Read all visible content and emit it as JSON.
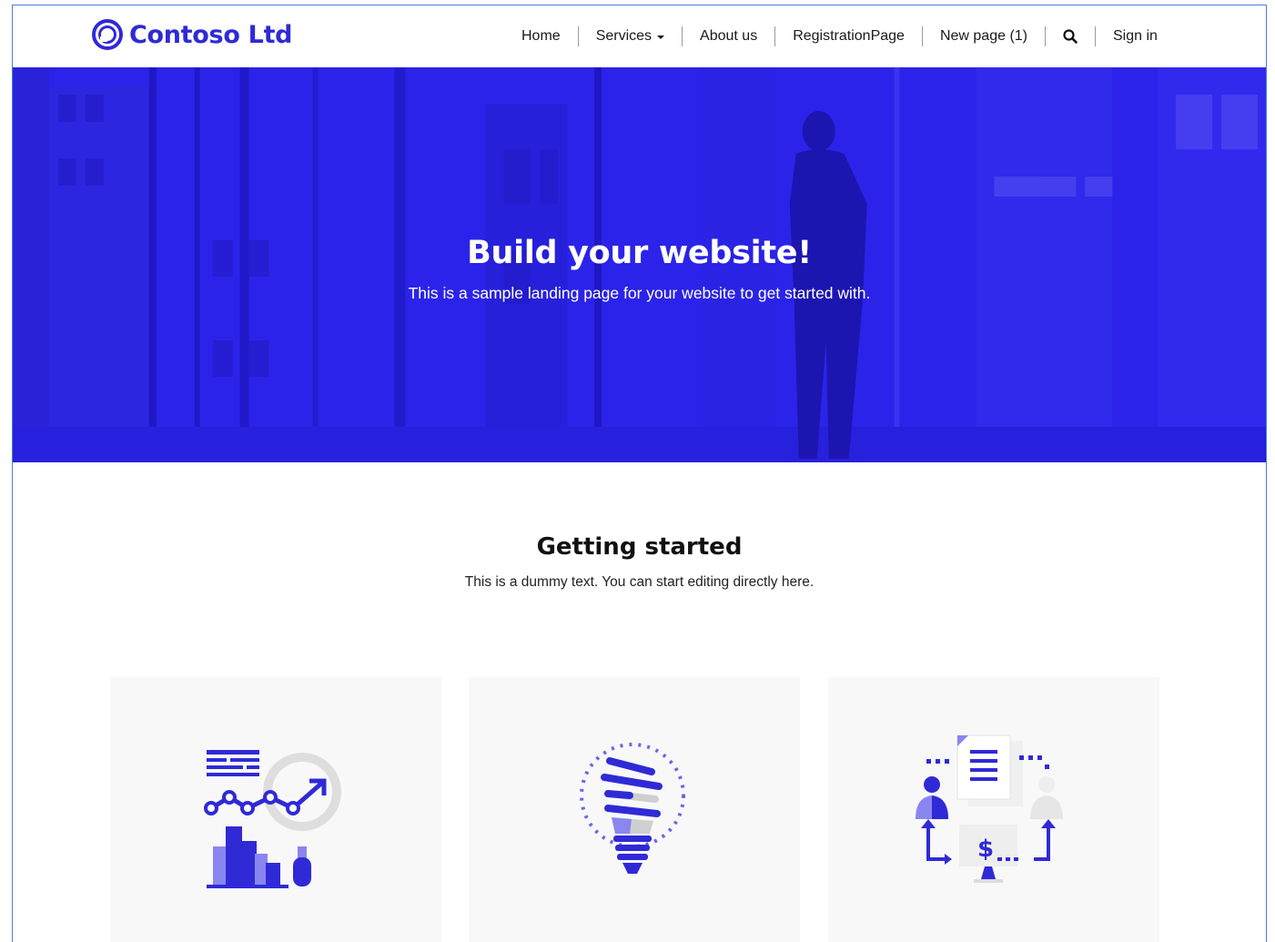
{
  "brand": {
    "name": "Contoso Ltd",
    "logo_icon": "ring-logo-icon",
    "color": "#2f2ad6"
  },
  "nav": {
    "home": "Home",
    "services": "Services",
    "about": "About us",
    "registration": "RegistrationPage",
    "new_page": "New page (1)",
    "search_icon": "search-icon",
    "sign_in": "Sign in"
  },
  "hero": {
    "title": "Build your website!",
    "subtitle": "This is a sample landing page for your website to get started with.",
    "overlay_color": "#2a22e8"
  },
  "getting_started": {
    "title": "Getting started",
    "subtitle": "This is a dummy text. You can start editing directly here."
  },
  "cards": [
    {
      "icon": "analytics-chart-icon"
    },
    {
      "icon": "lightbulb-icon"
    },
    {
      "icon": "payment-exchange-icon"
    }
  ],
  "colors": {
    "accent": "#2f2ad6",
    "accent_light": "#8a86ef",
    "card_bg": "#f8f8f8"
  }
}
